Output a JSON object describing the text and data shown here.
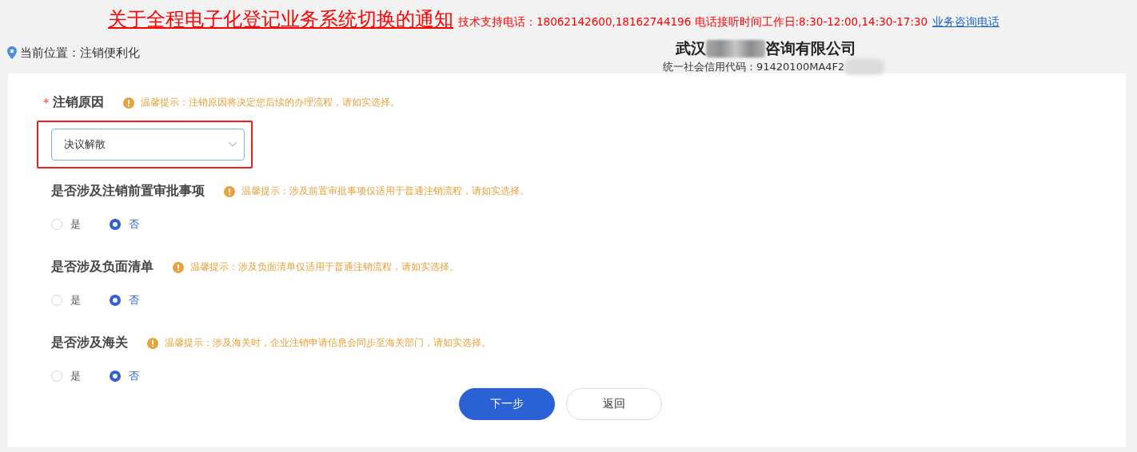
{
  "notice": {
    "title": "关于全程电子化登记业务系统切换的通知",
    "support": "技术支持电话：18062142600,18162744196 电话接听时间工作日:8:30-12:00,14:30-17:30",
    "link": "业务咨询电话"
  },
  "location": "当前位置：注销便利化",
  "company": {
    "name_start": "武汉",
    "name_end": "咨询有限公司",
    "code": "统一社会信用代码：91420100MA4F2",
    "redacted": true
  },
  "reason": {
    "label": "注销原因",
    "required_mark": "*",
    "hint": "温馨提示：注销原因将决定您后续的办理流程，请如实选择。",
    "value": "决议解散",
    "highlighted": true
  },
  "questions": [
    {
      "label": "是否涉及注销前置审批事项",
      "hint": "温馨提示：涉及前置审批事项仅适用于普通注销流程，请如实选择。",
      "options": [
        {
          "label": "是",
          "selected": false
        },
        {
          "label": "否",
          "selected": true
        }
      ]
    },
    {
      "label": "是否涉及负面清单",
      "hint": "温馨提示：涉及负面清单仅适用于普通注销流程，请如实选择。",
      "options": [
        {
          "label": "是",
          "selected": false
        },
        {
          "label": "否",
          "selected": true
        }
      ]
    },
    {
      "label": "是否涉及海关",
      "hint": "温馨提示：涉及海关时，企业注销申请信息会同步至海关部门，请如实选择。",
      "options": [
        {
          "label": "是",
          "selected": false
        },
        {
          "label": "否",
          "selected": true
        }
      ]
    }
  ],
  "buttons": [
    {
      "label": "下一步",
      "kind": "primary"
    },
    {
      "label": "返回",
      "kind": "secondary"
    }
  ]
}
